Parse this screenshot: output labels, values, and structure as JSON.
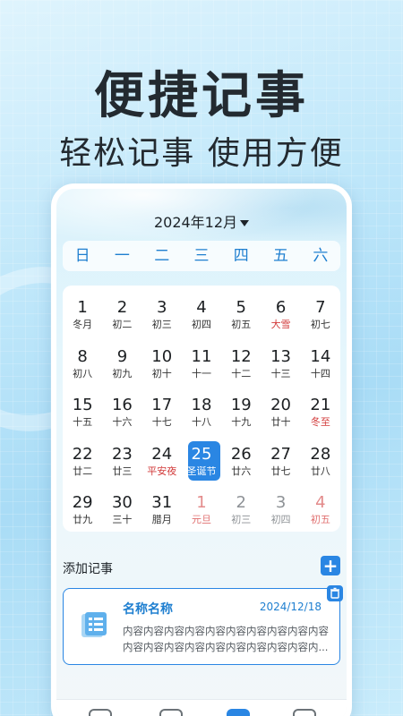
{
  "headline": "便捷记事",
  "subline": "轻松记事 使用方便",
  "calendar": {
    "month_label": "2024年12月",
    "weekdays": [
      "日",
      "一",
      "二",
      "三",
      "四",
      "五",
      "六"
    ],
    "days": [
      {
        "num": "1",
        "lunar": "冬月"
      },
      {
        "num": "2",
        "lunar": "初二"
      },
      {
        "num": "3",
        "lunar": "初三"
      },
      {
        "num": "4",
        "lunar": "初四"
      },
      {
        "num": "5",
        "lunar": "初五"
      },
      {
        "num": "6",
        "lunar": "大雪",
        "red": true
      },
      {
        "num": "7",
        "lunar": "初七"
      },
      {
        "num": "8",
        "lunar": "初八"
      },
      {
        "num": "9",
        "lunar": "初九"
      },
      {
        "num": "10",
        "lunar": "初十"
      },
      {
        "num": "11",
        "lunar": "十一"
      },
      {
        "num": "12",
        "lunar": "十二"
      },
      {
        "num": "13",
        "lunar": "十三"
      },
      {
        "num": "14",
        "lunar": "十四"
      },
      {
        "num": "15",
        "lunar": "十五"
      },
      {
        "num": "16",
        "lunar": "十六"
      },
      {
        "num": "17",
        "lunar": "十七"
      },
      {
        "num": "18",
        "lunar": "十八"
      },
      {
        "num": "19",
        "lunar": "十九"
      },
      {
        "num": "20",
        "lunar": "廿十"
      },
      {
        "num": "21",
        "lunar": "冬至",
        "red": true
      },
      {
        "num": "22",
        "lunar": "廿二"
      },
      {
        "num": "23",
        "lunar": "廿三"
      },
      {
        "num": "24",
        "lunar": "平安夜",
        "red": true
      },
      {
        "num": "25",
        "lunar": "圣诞节",
        "selected": true
      },
      {
        "num": "26",
        "lunar": "廿六"
      },
      {
        "num": "27",
        "lunar": "廿七"
      },
      {
        "num": "28",
        "lunar": "廿八"
      },
      {
        "num": "29",
        "lunar": "廿九"
      },
      {
        "num": "30",
        "lunar": "三十"
      },
      {
        "num": "31",
        "lunar": "腊月"
      },
      {
        "num": "1",
        "lunar": "元旦",
        "red": true,
        "muted": true
      },
      {
        "num": "2",
        "lunar": "初三",
        "muted": true
      },
      {
        "num": "3",
        "lunar": "初四",
        "muted": true
      },
      {
        "num": "4",
        "lunar": "初五",
        "muted": true,
        "red": true
      }
    ]
  },
  "notes": {
    "section_label": "添加记事",
    "add_icon": "plus-icon",
    "items": [
      {
        "title": "名称名称",
        "date": "2024/12/18",
        "body": "内容内容内容内容内容内容内容内容内容内容内容内容内容内容内容内容内容内容内容内..."
      }
    ]
  },
  "tabbar": {
    "tabs": [
      {
        "icon": "home-icon"
      },
      {
        "icon": "calendar-grid-icon"
      },
      {
        "icon": "notes-icon",
        "active": true
      },
      {
        "icon": "user-icon"
      }
    ]
  },
  "colors": {
    "accent": "#2a86e3",
    "holiday_red": "#d23b3b",
    "headline_text": "#232a30"
  }
}
